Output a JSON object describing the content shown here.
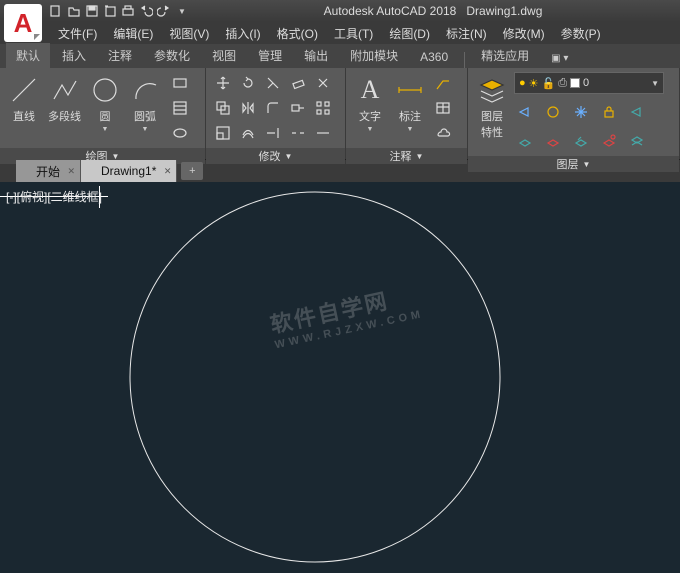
{
  "app": {
    "title": "Autodesk AutoCAD 2018",
    "file": "Drawing1.dwg",
    "logo": "A"
  },
  "menus": [
    {
      "label": "文件(F)"
    },
    {
      "label": "编辑(E)"
    },
    {
      "label": "视图(V)"
    },
    {
      "label": "插入(I)"
    },
    {
      "label": "格式(O)"
    },
    {
      "label": "工具(T)"
    },
    {
      "label": "绘图(D)"
    },
    {
      "label": "标注(N)"
    },
    {
      "label": "修改(M)"
    },
    {
      "label": "参数(P)"
    }
  ],
  "ribbon_tabs": {
    "active": "默认",
    "group1": [
      "默认",
      "插入",
      "注释",
      "参数化",
      "视图",
      "管理",
      "输出",
      "附加模块",
      "A360"
    ],
    "group2": [
      "精选应用"
    ]
  },
  "panels": {
    "draw": {
      "title": "绘图",
      "big": [
        {
          "label": "直线"
        },
        {
          "label": "多段线"
        },
        {
          "label": "圆"
        },
        {
          "label": "圆弧"
        }
      ]
    },
    "modify": {
      "title": "修改"
    },
    "annot": {
      "title": "注释",
      "big": [
        {
          "label": "文字"
        },
        {
          "label": "标注"
        }
      ]
    },
    "layer": {
      "title": "图层",
      "big_label": "图层\n特性",
      "current": "0"
    }
  },
  "filetabs": [
    {
      "label": "开始",
      "active": false
    },
    {
      "label": "Drawing1*",
      "active": true
    }
  ],
  "viewport": {
    "label_parts": [
      "[-]",
      "[俯视]",
      "[二维线框]"
    ]
  },
  "watermark": {
    "main": "软件自学网",
    "sub": "WWW.RJZXW.COM"
  }
}
